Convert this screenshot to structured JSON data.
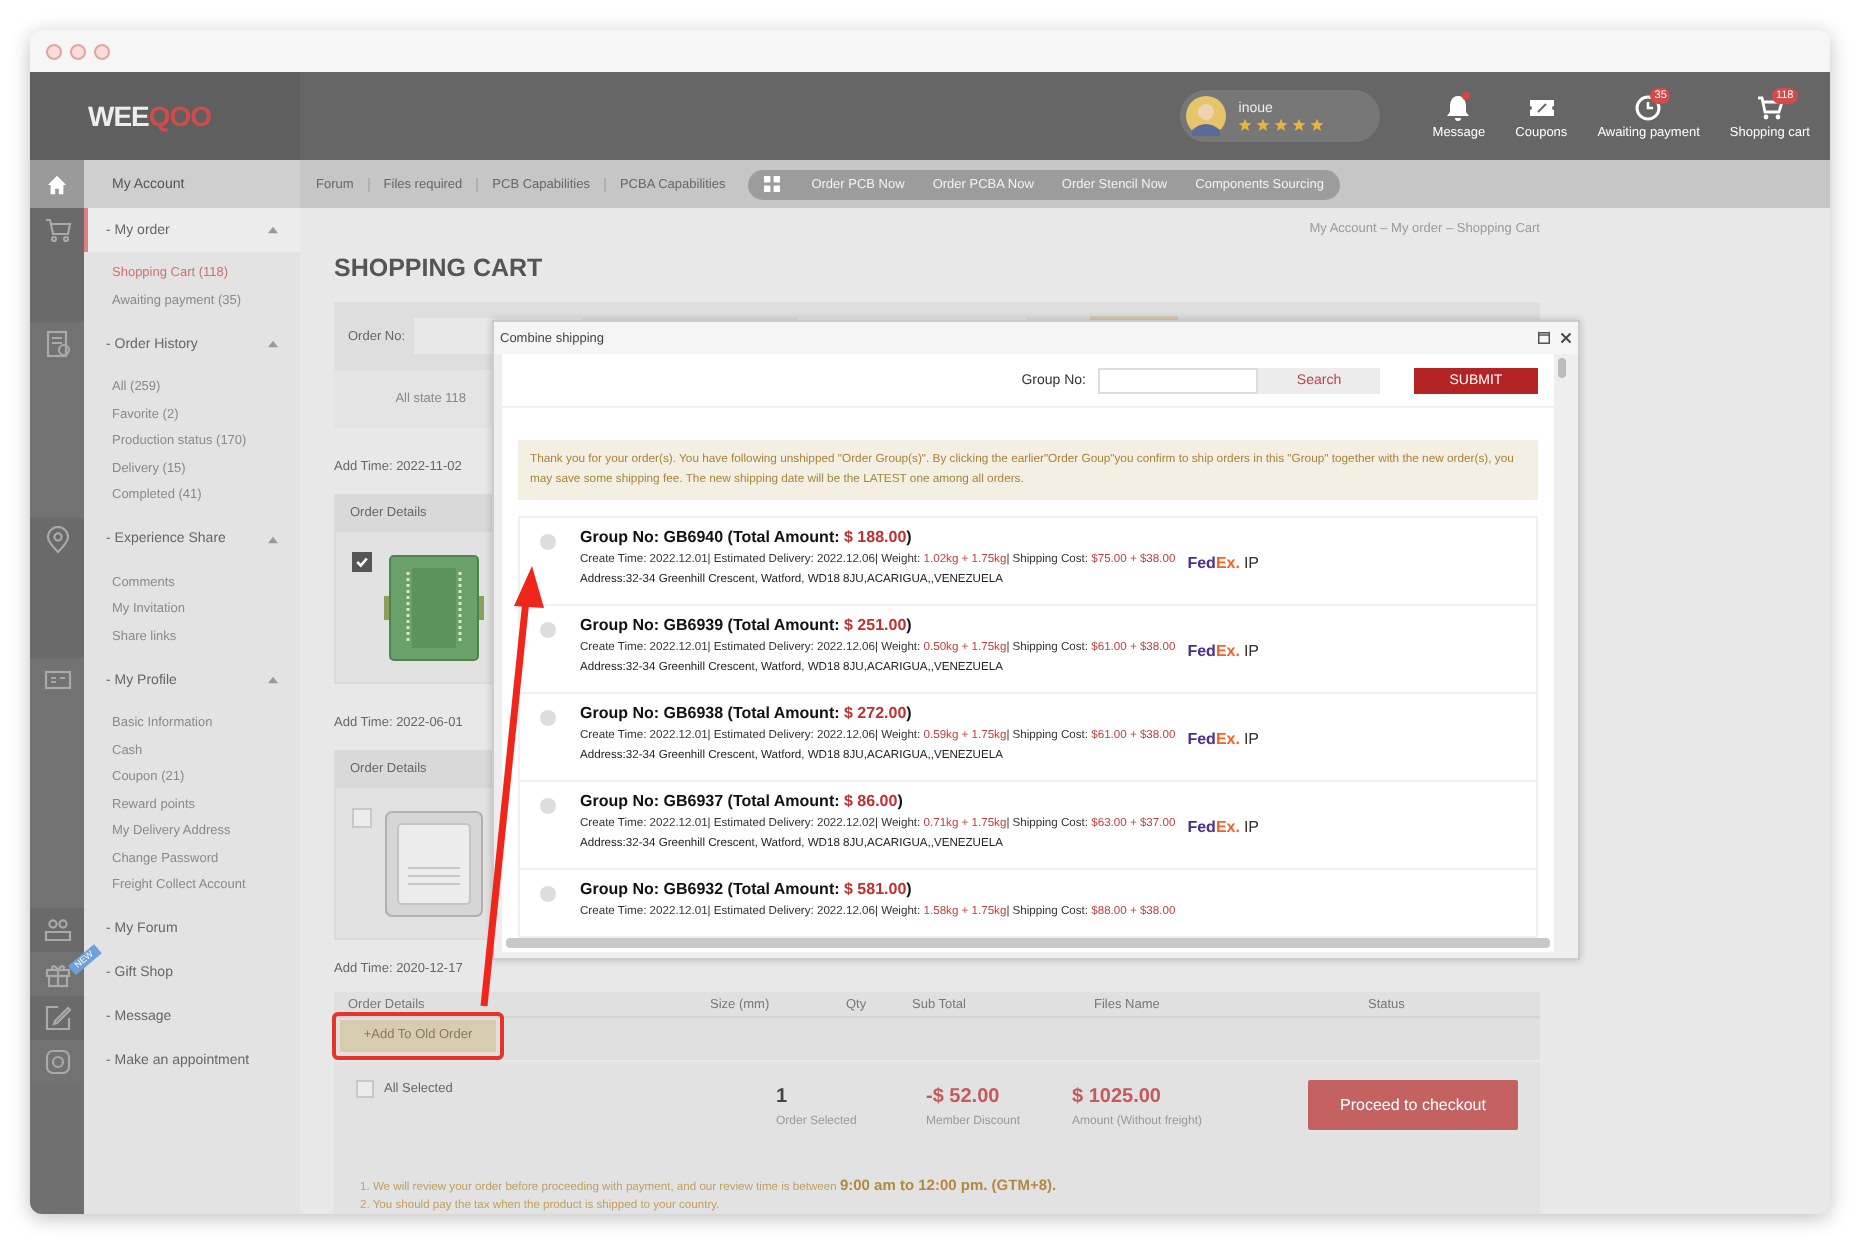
{
  "header": {
    "logo": [
      "WEE",
      "QOO"
    ],
    "user": {
      "name": "inoue",
      "stars": 5
    },
    "actions": [
      {
        "kind": "bell",
        "label": "Message",
        "dot": true
      },
      {
        "kind": "coupon",
        "label": "Coupons",
        "dot": false
      },
      {
        "kind": "clock",
        "label": "Awaiting payment",
        "badge": "35",
        "dot": false
      },
      {
        "kind": "cart",
        "label": "Shopping cart",
        "badge": "118",
        "dot": false
      }
    ]
  },
  "nav": {
    "home_label": "My Account",
    "links": [
      "Forum",
      "Files required",
      "PCB Capabilities",
      "PCBA Capabilities"
    ],
    "quick_links": [
      "Order PCB Now",
      "Order PCBA Now",
      "Order Stencil Now",
      "Components Sourcing"
    ]
  },
  "sidebar": {
    "groups": [
      {
        "title": "- My order",
        "selected": true,
        "expanded": true,
        "items": [
          {
            "label": "Shopping Cart (118)",
            "selected": true
          },
          {
            "label": "Awaiting payment (35)",
            "selected": false
          }
        ]
      },
      {
        "title": "- Order History",
        "selected": false,
        "expanded": true,
        "items": [
          {
            "label": "All (259)",
            "selected": false
          },
          {
            "label": "Favorite (2)",
            "selected": false
          },
          {
            "label": "Production status (170)",
            "selected": false
          },
          {
            "label": "Delivery (15)",
            "selected": false
          },
          {
            "label": "Completed (41)",
            "selected": false
          }
        ]
      },
      {
        "title": "- Experience Share",
        "selected": false,
        "expanded": true,
        "items": [
          {
            "label": "Comments",
            "selected": false
          },
          {
            "label": "My Invitation",
            "selected": false
          },
          {
            "label": "Share links",
            "selected": false
          }
        ]
      },
      {
        "title": "- My Profile",
        "selected": false,
        "expanded": true,
        "items": [
          {
            "label": "Basic Information",
            "selected": false
          },
          {
            "label": "Cash",
            "selected": false
          },
          {
            "label": "Coupon (21)",
            "selected": false
          },
          {
            "label": "Reward points",
            "selected": false
          },
          {
            "label": "My Delivery Address",
            "selected": false
          },
          {
            "label": "Change Password",
            "selected": false
          },
          {
            "label": "Freight Collect Account",
            "selected": false
          }
        ]
      },
      {
        "title": "- My Forum",
        "selected": false,
        "expanded": false
      },
      {
        "title": "- Gift Shop",
        "selected": false,
        "expanded": false,
        "badge": "NEW"
      },
      {
        "title": "- Message",
        "selected": false,
        "expanded": false
      },
      {
        "title": "- Make an appointment",
        "selected": false,
        "expanded": false
      }
    ]
  },
  "page": {
    "breadcrumb": "My Account  –  My order  –  Shopping Cart",
    "title": "SHOPPING CART",
    "filter": {
      "label": "Order No:",
      "state": "All state 118"
    },
    "orders": [
      {
        "add_time": "Add Time: 2022-11-02",
        "details_label": "Order Details",
        "checked": true,
        "kind": "green"
      },
      {
        "add_time": "Add Time: 2022-06-01",
        "details_label": "Order Details",
        "checked": false,
        "kind": "silver"
      }
    ],
    "last_add_time": "Add Time: 2020-12-17",
    "columns": [
      "Order Details",
      "Size (mm)",
      "Qty",
      "Sub Total",
      "Files Name",
      "Status"
    ],
    "add_button": "+Add To Old Order",
    "summary": {
      "all_label": "All Selected",
      "all_checked": false,
      "stats": [
        {
          "kind": "count",
          "value": "1",
          "label": "Order Selected"
        },
        {
          "kind": "money",
          "value": "-$ 52.00",
          "label": "Member Discount"
        },
        {
          "kind": "money",
          "value": "$ 1025.00",
          "label": "Amount (Without freight)"
        }
      ],
      "checkout": "Proceed to checkout"
    },
    "notes": [
      "1. We will review your order before proceeding with payment, and our review time is between **9:00 am to 12:00 pm. (GTM+8).**",
      "2. You should pay the tax when the product is shipped to your country."
    ]
  },
  "modal": {
    "title": "Combine shipping",
    "group_label": "Group No:",
    "search": "Search",
    "submit": "SUBMIT",
    "notice": "Thank you for your order(s). You have following unshipped \"Order Group(s)\". By clicking the earlier\"Order Goup\"you confirm to ship orders in this \"Group\" together with the new order(s), you may save some shipping fee. The new shipping date will be the LATEST one among all orders.",
    "groups": [
      {
        "selected": false,
        "title": "Group No: GB6940 (Total Amount: ",
        "amount": "$ 188.00",
        "close": ")",
        "details": [
          {
            "text": "Create Time: 2022.12.01| Estimated Delivery: 2022.12.06| Weight: ",
            "highlight": false
          },
          {
            "text": "1.02kg + 1.75kg",
            "highlight": true
          },
          {
            "text": "| Shipping Cost: ",
            "highlight": false
          },
          {
            "text": "$75.00 + $38.00",
            "highlight": true
          }
        ],
        "carrier": [
          "Fed",
          "Ex."
        ],
        "service": "IP",
        "address": "Address:32-34 Greenhill Crescent, Watford, WD18 8JU,ACARIGUA,,VENEZUELA"
      },
      {
        "selected": false,
        "title": "Group No: GB6939 (Total Amount: ",
        "amount": "$ 251.00",
        "close": ")",
        "details": [
          {
            "text": "Create Time: 2022.12.01| Estimated Delivery: 2022.12.06| Weight: ",
            "highlight": false
          },
          {
            "text": "0.50kg + 1.75kg",
            "highlight": true
          },
          {
            "text": "| Shipping Cost: ",
            "highlight": false
          },
          {
            "text": "$61.00 + $38.00",
            "highlight": true
          }
        ],
        "carrier": [
          "Fed",
          "Ex."
        ],
        "service": "IP",
        "address": "Address:32-34 Greenhill Crescent, Watford, WD18 8JU,ACARIGUA,,VENEZUELA"
      },
      {
        "selected": false,
        "title": "Group No: GB6938 (Total Amount: ",
        "amount": "$ 272.00",
        "close": ")",
        "details": [
          {
            "text": "Create Time: 2022.12.01| Estimated Delivery: 2022.12.06| Weight: ",
            "highlight": false
          },
          {
            "text": "0.59kg + 1.75kg",
            "highlight": true
          },
          {
            "text": "| Shipping Cost: ",
            "highlight": false
          },
          {
            "text": "$61.00 + $38.00",
            "highlight": true
          }
        ],
        "carrier": [
          "Fed",
          "Ex."
        ],
        "service": "IP",
        "address": "Address:32-34 Greenhill Crescent, Watford, WD18 8JU,ACARIGUA,,VENEZUELA"
      },
      {
        "selected": false,
        "title": "Group No: GB6937 (Total Amount: ",
        "amount": "$ 86.00",
        "close": ")",
        "details": [
          {
            "text": "Create Time: 2022.12.01| Estimated Delivery: 2022.12.02| Weight: ",
            "highlight": false
          },
          {
            "text": "0.71kg + 1.75kg",
            "highlight": true
          },
          {
            "text": "| Shipping Cost: ",
            "highlight": false
          },
          {
            "text": "$63.00 + $37.00",
            "highlight": true
          }
        ],
        "carrier": [
          "Fed",
          "Ex."
        ],
        "service": "IP",
        "address": "Address:32-34 Greenhill Crescent, Watford, WD18 8JU,ACARIGUA,,VENEZUELA"
      },
      {
        "selected": false,
        "title": "Group No: GB6932 (Total Amount: ",
        "amount": "$ 581.00",
        "close": ")",
        "details": [
          {
            "text": "Create Time: 2022.12.01| Estimated Delivery: 2022.12.06| Weight: ",
            "highlight": false
          },
          {
            "text": "1.58kg + 1.75kg",
            "highlight": true
          },
          {
            "text": "| Shipping Cost: ",
            "highlight": false
          },
          {
            "text": "$88.00 + $38.00",
            "highlight": true
          }
        ]
      }
    ]
  }
}
